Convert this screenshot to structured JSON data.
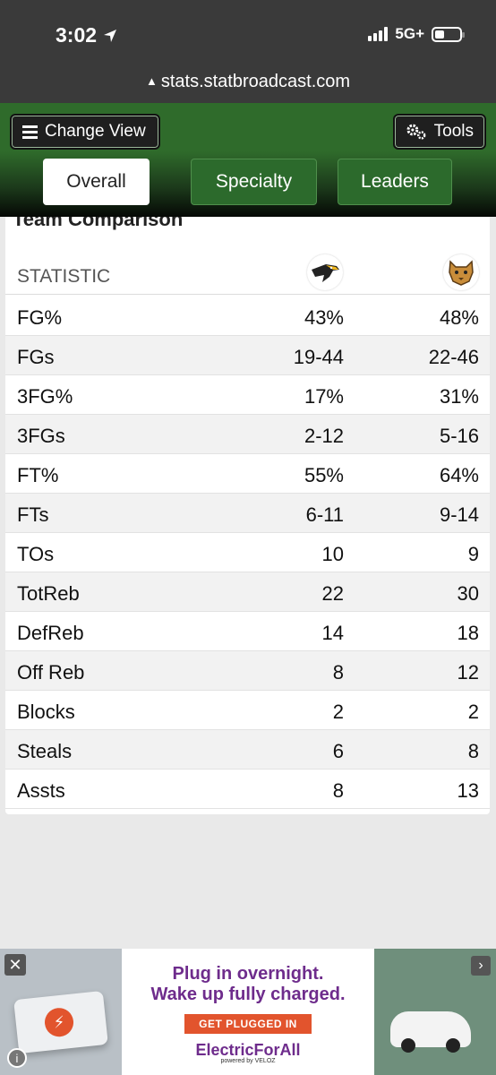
{
  "status_bar": {
    "time": "3:02",
    "network": "5G+"
  },
  "browser": {
    "url": "stats.statbroadcast.com"
  },
  "toolbar": {
    "change_view_label": "Change View",
    "tools_label": "Tools"
  },
  "tabs": [
    {
      "label": "Overall",
      "active": true
    },
    {
      "label": "Specialty",
      "active": false
    },
    {
      "label": "Leaders",
      "active": false
    }
  ],
  "comparison": {
    "title": "Team Comparison",
    "header": "STATISTIC",
    "rows": [
      {
        "stat": "FG%",
        "team1": "43%",
        "team2": "48%"
      },
      {
        "stat": "FGs",
        "team1": "19-44",
        "team2": "22-46"
      },
      {
        "stat": "3FG%",
        "team1": "17%",
        "team2": "31%"
      },
      {
        "stat": "3FGs",
        "team1": "2-12",
        "team2": "5-16"
      },
      {
        "stat": "FT%",
        "team1": "55%",
        "team2": "64%"
      },
      {
        "stat": "FTs",
        "team1": "6-11",
        "team2": "9-14"
      },
      {
        "stat": "TOs",
        "team1": "10",
        "team2": "9"
      },
      {
        "stat": "TotReb",
        "team1": "22",
        "team2": "30"
      },
      {
        "stat": "DefReb",
        "team1": "14",
        "team2": "18"
      },
      {
        "stat": "Off Reb",
        "team1": "8",
        "team2": "12"
      },
      {
        "stat": "Blocks",
        "team1": "2",
        "team2": "2"
      },
      {
        "stat": "Steals",
        "team1": "6",
        "team2": "8"
      },
      {
        "stat": "Assts",
        "team1": "8",
        "team2": "13"
      }
    ]
  },
  "ad": {
    "headline1": "Plug in overnight.",
    "headline2": "Wake up fully charged.",
    "cta": "GET PLUGGED IN",
    "brand": "ElectricForAll",
    "powered": "powered by VELOZ"
  },
  "colors": {
    "nav_green": "#2f6b2b",
    "ad_purple": "#6e2c8c",
    "ad_orange": "#e2542d"
  }
}
